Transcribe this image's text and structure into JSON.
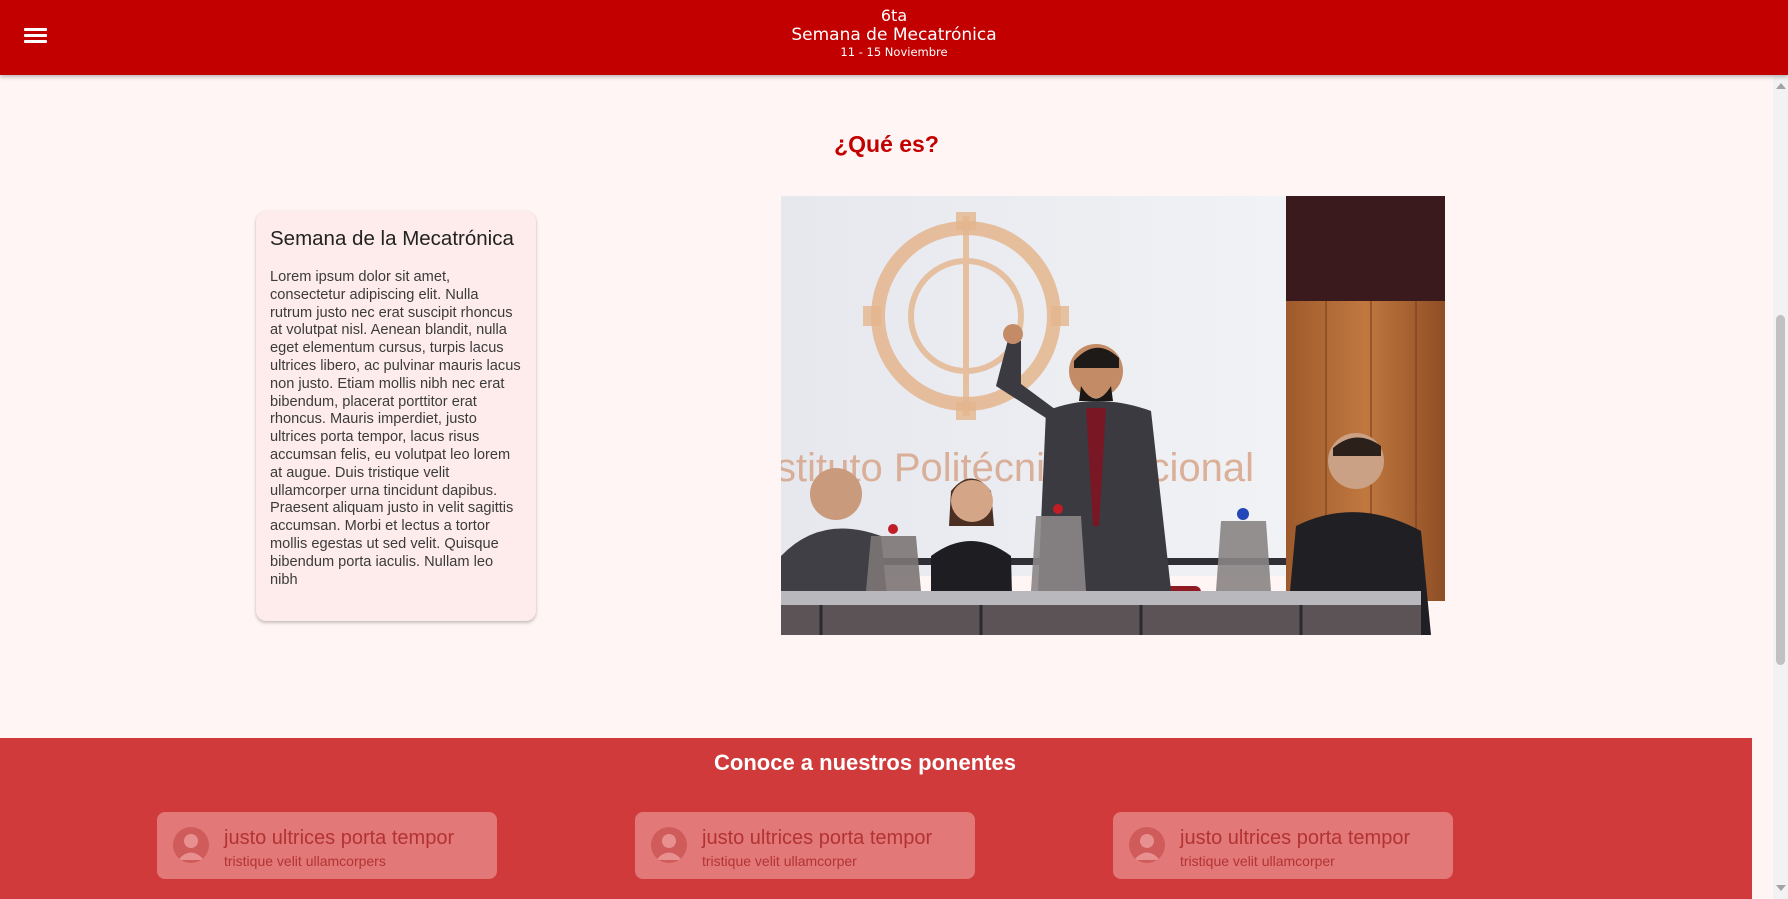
{
  "header": {
    "edition": "6ta",
    "event_name": "Semana de Mecatrónica",
    "dates": "11 - 15 Noviembre",
    "menu_icon": "hamburger-menu-icon",
    "background_color": "#c20000"
  },
  "about": {
    "heading": "¿Qué es?",
    "card": {
      "title": "Semana de la Mecatrónica",
      "body": "Lorem ipsum dolor sit amet, consectetur adipiscing elit. Nulla rutrum justo nec erat suscipit rhoncus at volutpat nisl. Aenean blandit, nulla eget elementum cursus, turpis lacus ultrices libero, ac pulvinar mauris lacus non justo. Etiam mollis nibh nec erat bibendum, placerat porttitor erat rhoncus. Mauris imperdiet, justo ultrices porta tempor, lacus risus accumsan felis, eu volutpat leo lorem at augue. Duis tristique velit ullamcorper urna tincidunt dapibus. Praesent aliquam justo in velit sagittis accumsan. Morbi et lectus a tortor mollis egestas ut sed velit. Quisque bibendum porta iaculis. Nullam leo nibh"
    },
    "photo_text": "stituto Politécnico Nacional"
  },
  "speakers": {
    "heading": "Conoce a nuestros ponentes",
    "background_color": "#d03a3a",
    "items": [
      {
        "name": "justo ultrices porta tempor",
        "subtitle": "tristique velit ullamcorpers"
      },
      {
        "name": "justo ultrices porta tempor",
        "subtitle": "tristique velit ullamcorper"
      },
      {
        "name": "justo ultrices porta tempor",
        "subtitle": "tristique velit ullamcorper"
      }
    ]
  }
}
